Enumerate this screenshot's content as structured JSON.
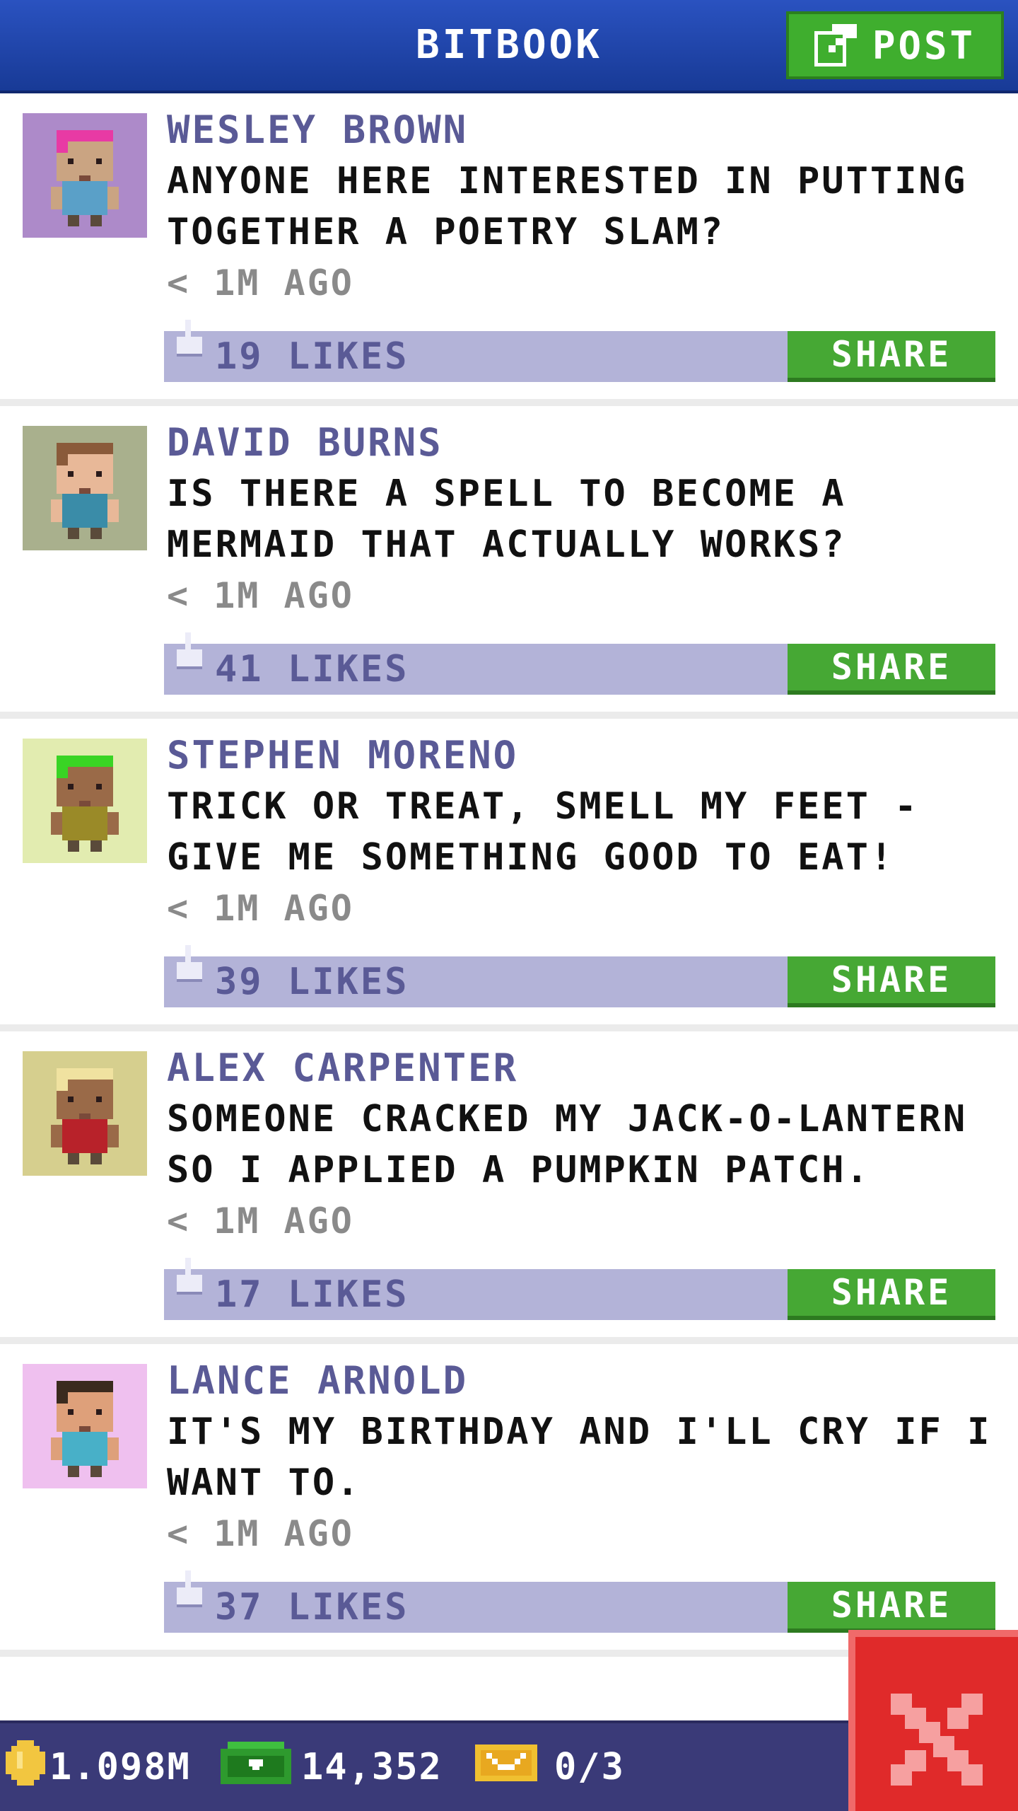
{
  "header": {
    "title": "BITBOOK",
    "post_label": "POST"
  },
  "posts": [
    {
      "author": "WESLEY BROWN",
      "text": "ANYONE HERE INTERESTED IN PUTTING TOGETHER A POETRY SLAM?",
      "time": "< 1M AGO",
      "likes": "19 LIKES",
      "share": "SHARE"
    },
    {
      "author": "DAVID BURNS",
      "text": "IS THERE A SPELL TO BECOME A MERMAID THAT ACTUALLY WORKS?",
      "time": "< 1M AGO",
      "likes": "41 LIKES",
      "share": "SHARE"
    },
    {
      "author": "STEPHEN MORENO",
      "text": "TRICK OR TREAT, SMELL MY FEET - GIVE ME SOMETHING GOOD TO EAT!",
      "time": "< 1M AGO",
      "likes": "39 LIKES",
      "share": "SHARE"
    },
    {
      "author": "ALEX CARPENTER",
      "text": "SOMEONE CRACKED MY JACK-O-LANTERN SO I APPLIED A PUMPKIN PATCH.",
      "time": "< 1M AGO",
      "likes": "17 LIKES",
      "share": "SHARE"
    },
    {
      "author": "LANCE ARNOLD",
      "text": "IT'S MY BIRTHDAY AND I'LL CRY IF I WANT TO.",
      "time": "< 1M AGO",
      "likes": "37 LIKES",
      "share": "SHARE"
    }
  ],
  "footer": {
    "coins": "1.098M",
    "bux": "14,352",
    "tickets": "0/3"
  },
  "colors": {
    "header_blue": "#1f47b0",
    "post_green": "#3fae2e",
    "name_purple": "#5a5a96",
    "likebar": "#b3b3d8",
    "footer": "#3a3a78",
    "close_red": "#e02a2a"
  },
  "avatars": [
    {
      "bg": "#ad8ac9",
      "hair": "#e83aa4",
      "skin": "#caa482",
      "shirt": "#5aa0c8"
    },
    {
      "bg": "#a9b08d",
      "hair": "#8a5a3a",
      "skin": "#e8b898",
      "shirt": "#3a8ca8"
    },
    {
      "bg": "#e2ecb0",
      "hair": "#39d424",
      "skin": "#9a6a48",
      "shirt": "#9a8a28"
    },
    {
      "bg": "#d6cf8e",
      "hair": "#f0e2a0",
      "skin": "#9a6a48",
      "shirt": "#b8222a"
    },
    {
      "bg": "#efc0ef",
      "hair": "#3a2a1e",
      "skin": "#dea07a",
      "shirt": "#48b0c8"
    }
  ]
}
